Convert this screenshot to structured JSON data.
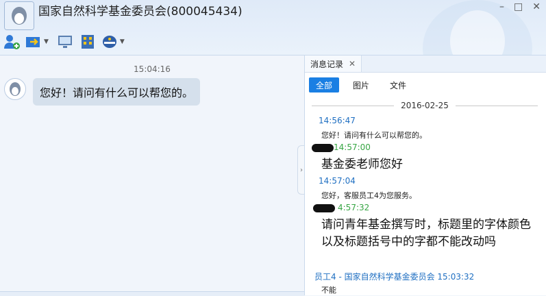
{
  "window": {
    "title": "国家自然科学基金委员会(800045434)",
    "buttons": [
      "–",
      "□",
      "✕"
    ]
  },
  "toolbar": {
    "items": [
      {
        "icon": "add-contact-icon"
      },
      {
        "icon": "transfer-file-icon"
      },
      {
        "icon": "remote-desktop-icon"
      },
      {
        "icon": "app-grid-icon"
      },
      {
        "icon": "agent-icon"
      }
    ]
  },
  "chat": {
    "time": "15:04:16",
    "message": "您好！请问有什么可以帮您的。"
  },
  "history": {
    "tab_label": "消息记录",
    "tab_close": "✕",
    "filters": [
      "全部",
      "图片",
      "文件"
    ],
    "date": "2016-02-25",
    "messages": [
      {
        "time": "14:56:47",
        "sender": "",
        "text": "您好！请问有什么可以帮您的。",
        "kind": "agent"
      },
      {
        "time": "14:57:00",
        "sender": "",
        "text": "基金委老师您好",
        "kind": "user"
      },
      {
        "time": "14:57:04",
        "sender": "",
        "text": "您好，客服员工4为您服务。",
        "kind": "agent"
      },
      {
        "time": "4:57:32",
        "sender": "",
        "text": "请问青年基金撰写时，标题里的字体颜色以及标题括号中的字都不能改动吗",
        "kind": "user"
      },
      {
        "time": "员工4 - 国家自然科学基金委员会 15:03:32",
        "sender": "",
        "text": "不能",
        "kind": "agent"
      }
    ]
  },
  "colors": {
    "accent": "#1a7fe3",
    "agent_meta": "#1f6fc2",
    "user_meta": "#37a644"
  }
}
